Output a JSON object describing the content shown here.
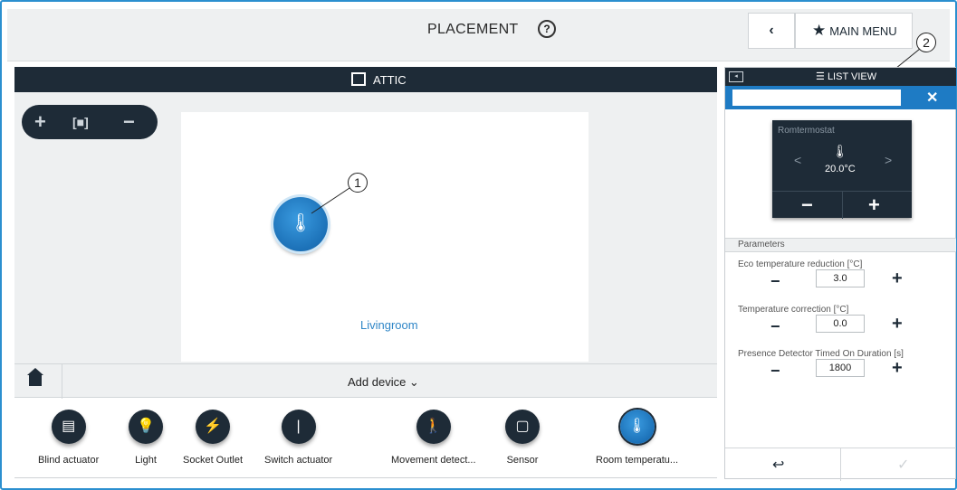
{
  "header": {
    "title": "PLACEMENT",
    "help_icon": "?",
    "back_icon": "‹",
    "main_menu_label": "MAIN MENU"
  },
  "callouts": {
    "one": "1",
    "two": "2"
  },
  "floor": {
    "label": "ATTIC"
  },
  "zoom": {
    "plus": "+",
    "fit": "[■]",
    "minus": "−"
  },
  "floorplan": {
    "room": "Livingroom"
  },
  "add_bar": {
    "label": "Add device ⌄"
  },
  "palette": [
    {
      "name": "Blind actuator",
      "icon": "▤"
    },
    {
      "name": "Light",
      "icon": "💡"
    },
    {
      "name": "Socket Outlet",
      "icon": "⚡"
    },
    {
      "name": "Switch actuator",
      "icon": "|"
    },
    {
      "name": "Movement detect...",
      "icon": "🚶"
    },
    {
      "name": "Sensor",
      "icon": "▢"
    },
    {
      "name": "Room temperatu...",
      "icon": "🌡"
    }
  ],
  "panel": {
    "list_view_label": "LIST VIEW",
    "list_icon": "☰",
    "search_value": "",
    "close": "✕",
    "device": {
      "name": "Romtermostat",
      "temperature": "20.0°C",
      "prev": "<",
      "next": ">",
      "minus": "−",
      "plus": "+"
    },
    "params_title": "Parameters",
    "params": [
      {
        "label": "Eco temperature reduction [°C]",
        "value": "3.0"
      },
      {
        "label": "Temperature correction [°C]",
        "value": "0.0"
      },
      {
        "label": "Presence Detector Timed On Duration [s]",
        "value": "1800"
      }
    ],
    "minus": "−",
    "plus": "+",
    "back_icon": "↩",
    "ok_icon": "✓"
  },
  "colors": {
    "accent": "#2b8fcf",
    "dark": "#1e2b37",
    "blue": "#1e7bc4"
  }
}
